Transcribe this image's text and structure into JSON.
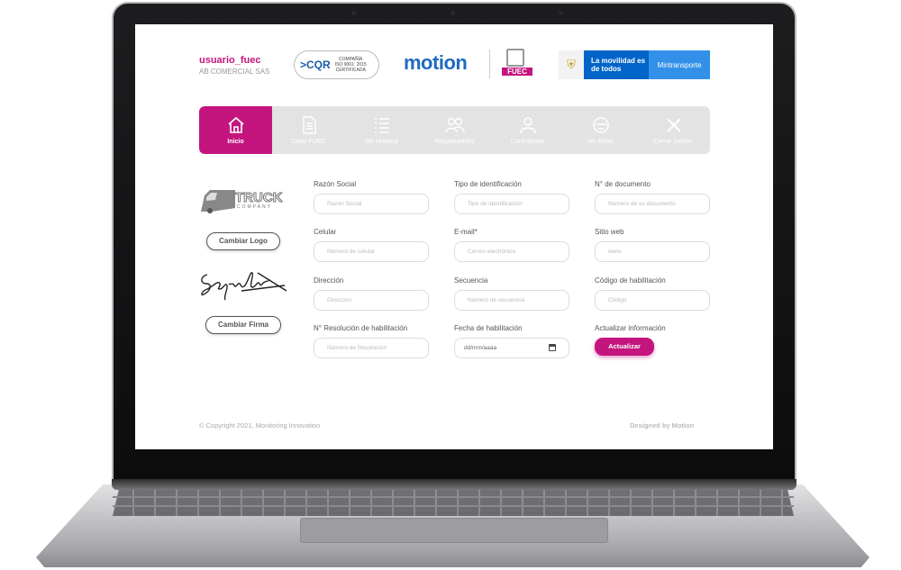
{
  "header": {
    "username": "usuario_fuec",
    "company": "AB COMERCIAL SAS",
    "cqr_mark": ">CQR",
    "cqr_text": [
      "COMPAÑÍA",
      "ISO 9001: 2015",
      "CERTIFICADA"
    ],
    "brand": "motion",
    "fuec_label": "FUEC",
    "gov_slogan": "La movilidad es de todos",
    "gov_ministry": "Mintransporte"
  },
  "nav": [
    {
      "label": "Inicio",
      "icon": "home-icon",
      "active": true
    },
    {
      "label": "Crear FUEC",
      "icon": "document-icon",
      "active": false
    },
    {
      "label": "Ver Historial",
      "icon": "list-icon",
      "active": false
    },
    {
      "label": "Responsables",
      "icon": "users-icon",
      "active": false
    },
    {
      "label": "Contratistas",
      "icon": "user-icon",
      "active": false
    },
    {
      "label": "Ver Rutas",
      "icon": "bus-icon",
      "active": false
    },
    {
      "label": "Cerrar Sesión",
      "icon": "close-icon",
      "active": false
    }
  ],
  "sidebar": {
    "logo_text": "TRUCK",
    "logo_subtext": "COMPANY",
    "change_logo": "Cambiar Logo",
    "change_signature": "Cambiar Firma"
  },
  "form": {
    "razon_social": {
      "label": "Razón Social",
      "placeholder": "Razón Social"
    },
    "tipo_identificacion": {
      "label": "Tipo de identificación",
      "placeholder": "Tipo de identificación"
    },
    "numero_documento": {
      "label": "N° de documento",
      "placeholder": "Número de su documento"
    },
    "celular": {
      "label": "Celular",
      "placeholder": "Número de celular"
    },
    "email": {
      "label": "E-mail*",
      "placeholder": "Correo electrónico"
    },
    "sitio_web": {
      "label": "Sitio web",
      "placeholder": "www."
    },
    "direccion": {
      "label": "Dirección",
      "placeholder": "Dirección"
    },
    "secuencia": {
      "label": "Secuencia",
      "placeholder": "Número de secuencia"
    },
    "codigo_habilitacion": {
      "label": "Código de habilitación",
      "placeholder": "Código"
    },
    "resolucion": {
      "label": "N° Resolución de habilitación",
      "placeholder": "Número de Resolución"
    },
    "fecha_habilitacion": {
      "label": "Fecha de habilitación",
      "value": "dd/mm/aaaa"
    },
    "actualizar_label": "Actualizar información",
    "actualizar_button": "Actualizar"
  },
  "footer": {
    "copyright": "© Copyright 2021, Monitoring Innovation",
    "designed": "Designed by Motion"
  },
  "colors": {
    "accent": "#c4157e",
    "nav_bg": "#e3e3e3",
    "gov_blue": "#0064c8"
  }
}
